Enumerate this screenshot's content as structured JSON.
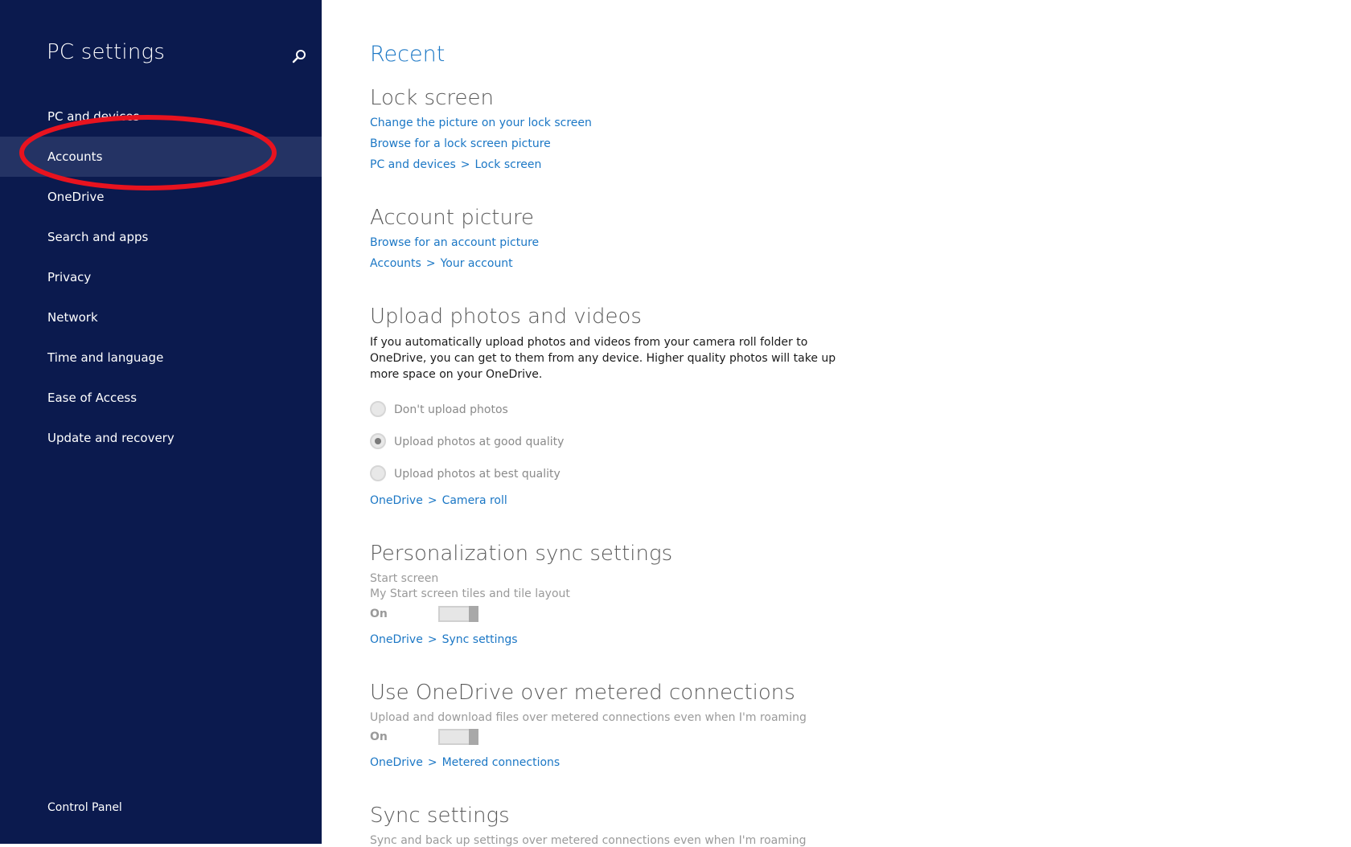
{
  "sidebar": {
    "title": "PC settings",
    "items": [
      {
        "label": "PC and devices"
      },
      {
        "label": "Accounts"
      },
      {
        "label": "OneDrive"
      },
      {
        "label": "Search and apps"
      },
      {
        "label": "Privacy"
      },
      {
        "label": "Network"
      },
      {
        "label": "Time and language"
      },
      {
        "label": "Ease of Access"
      },
      {
        "label": "Update and recovery"
      }
    ],
    "selected": "Accounts",
    "footer": "Control Panel"
  },
  "main": {
    "title": "Recent",
    "lock_screen": {
      "heading": "Lock screen",
      "link1": "Change the picture on your lock screen",
      "link2": "Browse for a lock screen picture",
      "crumb_a": "PC and devices",
      "crumb_sep": ">",
      "crumb_b": "Lock screen"
    },
    "account_picture": {
      "heading": "Account picture",
      "link1": "Browse for an account picture",
      "crumb_a": "Accounts",
      "crumb_sep": ">",
      "crumb_b": "Your account"
    },
    "upload": {
      "heading": "Upload photos and videos",
      "description": "If you automatically upload photos and videos from your camera roll folder to OneDrive, you can get to them from any device. Higher quality photos will take up more space on your OneDrive.",
      "options": [
        {
          "label": "Don't upload photos",
          "checked": false
        },
        {
          "label": "Upload photos at good quality",
          "checked": true
        },
        {
          "label": "Upload photos at best quality",
          "checked": false
        }
      ],
      "crumb_a": "OneDrive",
      "crumb_sep": ">",
      "crumb_b": "Camera roll"
    },
    "personalization": {
      "heading": "Personalization sync settings",
      "setting_name": "Start screen",
      "setting_desc": "My Start screen tiles and tile layout",
      "toggle_label": "On",
      "crumb_a": "OneDrive",
      "crumb_sep": ">",
      "crumb_b": "Sync settings"
    },
    "metered": {
      "heading": "Use OneDrive over metered connections",
      "setting_desc": "Upload and download files over metered connections even when I'm roaming",
      "toggle_label": "On",
      "crumb_a": "OneDrive",
      "crumb_sep": ">",
      "crumb_b": "Metered connections"
    },
    "sync": {
      "heading": "Sync settings",
      "setting_desc": "Sync and back up settings over metered connections even when I'm roaming"
    }
  },
  "colors": {
    "sidebar_bg": "#0b1a4e",
    "selected_bg": "#243364",
    "accent": "#1b77c5",
    "annotation": "#e8131f"
  }
}
